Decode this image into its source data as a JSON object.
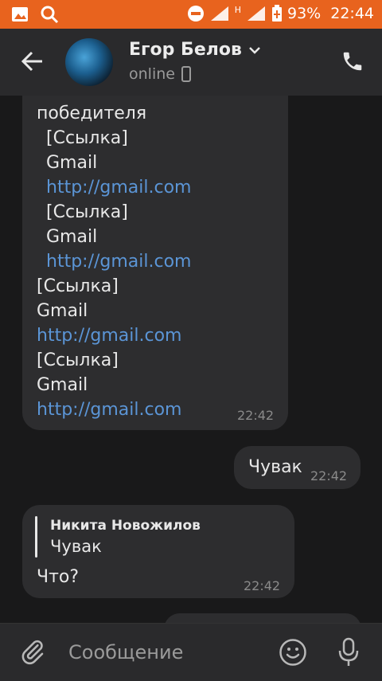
{
  "status_bar": {
    "battery": "93%",
    "time": "22:44",
    "network_letter": "H"
  },
  "header": {
    "contact_name": "Егор Белов",
    "presence": "online"
  },
  "messages": {
    "m1": {
      "lines": [
        "победителя",
        "[Ссылка]",
        "Gmail",
        "http://gmail.com",
        "[Ссылка]",
        "Gmail",
        "http://gmail.com",
        "[Ссылка]",
        "Gmail",
        "http://gmail.com",
        "[Ссылка]",
        "Gmail",
        "http://gmail.com"
      ],
      "time": "22:42"
    },
    "m2": {
      "text": "Чувак",
      "time": "22:42"
    },
    "m3": {
      "quote_author": "Никита Новожилов",
      "quote_text": "Чувак",
      "text": "Что?",
      "time": "22:42"
    }
  },
  "composer": {
    "placeholder": "Сообщение"
  },
  "colors": {
    "status_bar": "#e8631e",
    "background": "#19191a",
    "bubble": "#2d2d2f",
    "link": "#5b95d6"
  }
}
